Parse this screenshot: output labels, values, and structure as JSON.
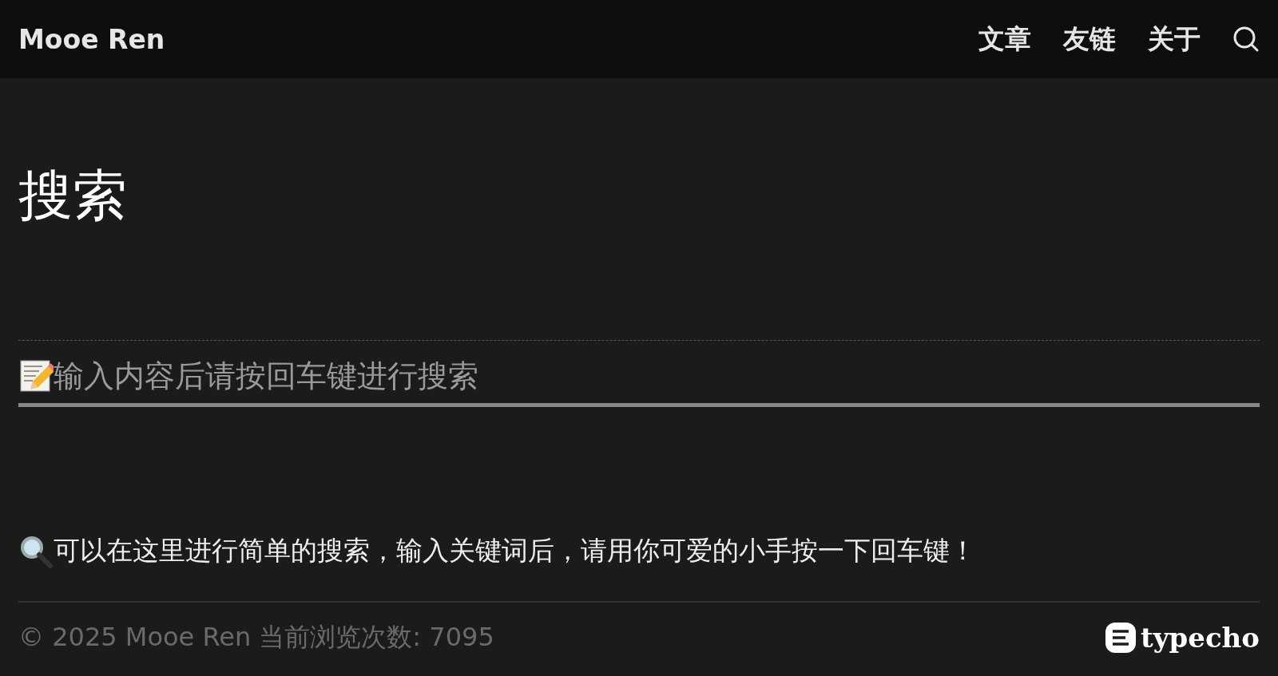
{
  "header": {
    "site_title": "Mooe Ren",
    "nav": [
      {
        "label": "文章"
      },
      {
        "label": "友链"
      },
      {
        "label": "关于"
      }
    ]
  },
  "page_title": "搜索",
  "search": {
    "placeholder": "输入内容后请按回车键进行搜索"
  },
  "hint": "可以在这里进行简单的搜索，输入关键词后，请用你可爱的小手按一下回车键！",
  "footer": {
    "text": "© 2025 Mooe Ren 当前浏览次数: 7095",
    "powered_by": "typecho"
  }
}
